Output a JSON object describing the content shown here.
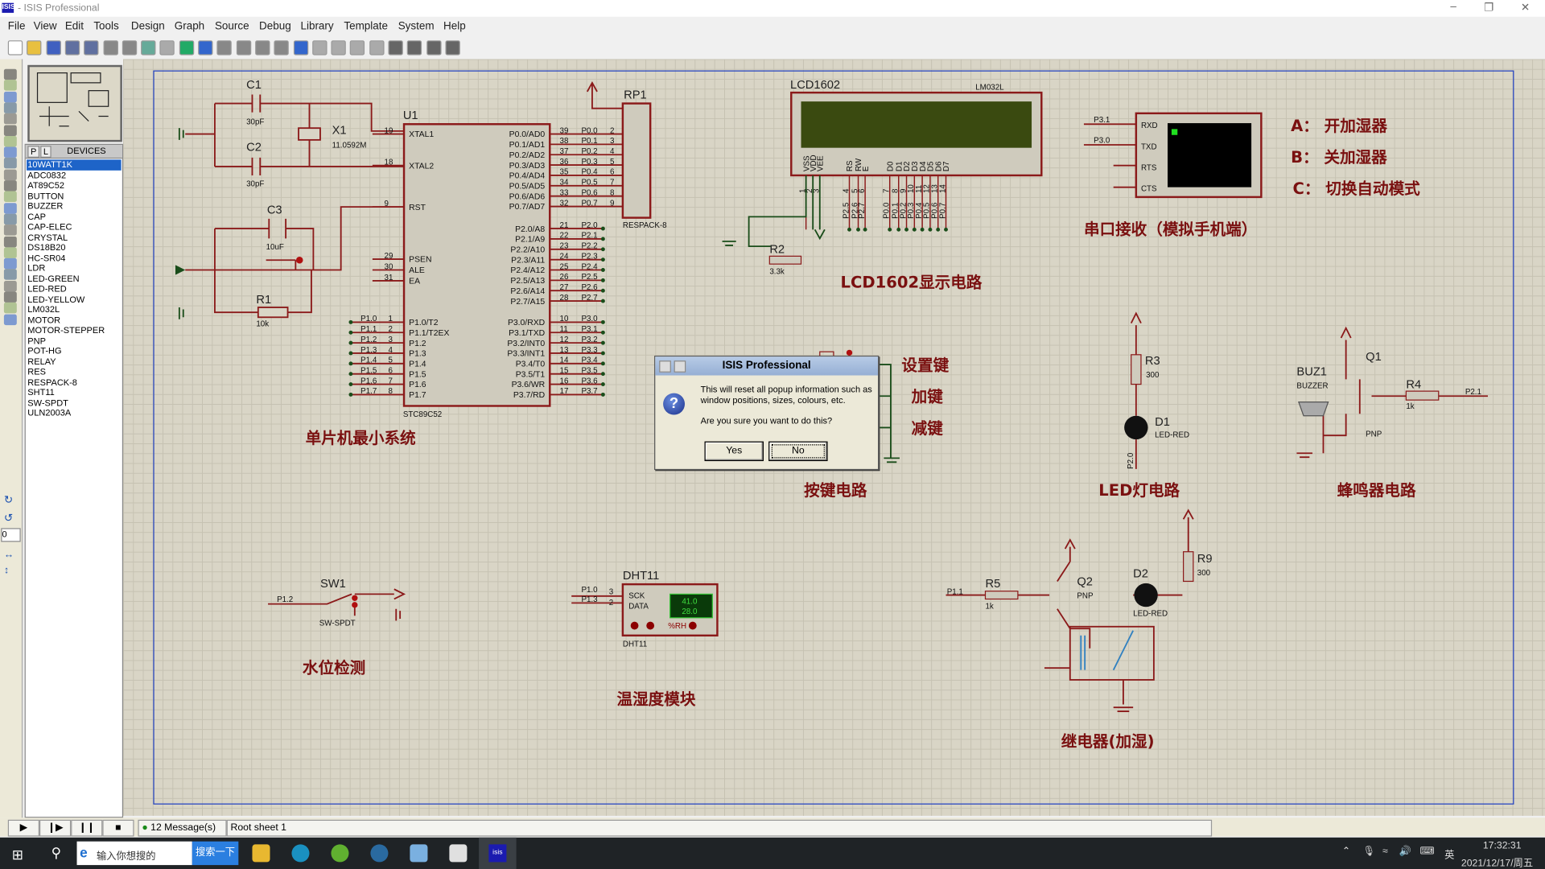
{
  "window": {
    "title": " - ISIS Professional",
    "app_icon": "ISIS",
    "controls": [
      "minimize",
      "restore",
      "close"
    ]
  },
  "menu": [
    "File",
    "View",
    "Edit",
    "Tools",
    "Design",
    "Graph",
    "Source",
    "Debug",
    "Library",
    "Template",
    "System",
    "Help"
  ],
  "device_panel": {
    "tab_p": "P",
    "tab_l": "L",
    "header": "DEVICES",
    "selected": "10WATT1K",
    "items": [
      "10WATT1K",
      "ADC0832",
      "AT89C52",
      "BUTTON",
      "BUZZER",
      "CAP",
      "CAP-ELEC",
      "CRYSTAL",
      "DS18B20",
      "HC-SR04",
      "LDR",
      "LED-GREEN",
      "LED-RED",
      "LED-YELLOW",
      "LM032L",
      "MOTOR",
      "MOTOR-STEPPER",
      "PNP",
      "POT-HG",
      "RELAY",
      "RES",
      "RESPACK-8",
      "SHT11",
      "SW-SPDT",
      "ULN2003A"
    ]
  },
  "rotation_value": "0",
  "schematic": {
    "titles": {
      "mcu": "单片机最小系统",
      "lcd": "LCD1602显示电路",
      "serial": "串口接收（模拟手机端）",
      "keys": "按键电路",
      "led": "LED灯电路",
      "buzzer": "蜂鸣器电路",
      "water": "水位检测",
      "dht": "温湿度模块",
      "relay": "继电器(加湿)",
      "set_key": "设置键",
      "plus_key": "加键",
      "minus_key": "减键"
    },
    "commands": [
      "A：  开加湿器",
      "B：  关加湿器",
      "C：  切换自动模式"
    ],
    "components": {
      "c1": "C1",
      "c1_val": "30pF",
      "c2": "C2",
      "c2_val": "30pF",
      "x1": "X1",
      "x1_val": "11.0592M",
      "c3": "C3",
      "c3_val": "10uF",
      "r1": "R1",
      "r1_val": "10k",
      "u1": "U1",
      "u1_part": "STC89C52",
      "rp1": "RP1",
      "rp1_part": "RESPACK-8",
      "lcd": "LCD1602",
      "lcd_part": "LM032L",
      "r2": "R2",
      "r2_val": "3.3k",
      "r3": "R3",
      "r3_val": "300",
      "d1": "D1",
      "d1_part": "LED-RED",
      "d1_net": "P2.0",
      "buz1": "BUZ1",
      "buz1_part": "BUZZER",
      "q1": "Q1",
      "q1_part": "PNP",
      "r4": "R4",
      "r4_val": "1k",
      "r4_net": "P2.1",
      "sw1": "SW1",
      "sw1_part": "SW-SPDT",
      "sw1_net": "P1.2",
      "dht": "DHT11",
      "dht_part": "DHT11",
      "dht_sck": "SCK",
      "dht_data": "DATA",
      "dht_net1": "P1.0",
      "dht_net2": "P1.3",
      "dht_pin1": "3",
      "dht_pin2": "2",
      "dht_hum": "41.0",
      "dht_temp": "28.0",
      "dht_unit": "%RH",
      "r5": "R5",
      "r5_val": "1k",
      "r5_net": "P1.1",
      "q2": "Q2",
      "q2_part": "PNP",
      "d2": "D2",
      "d2_part": "LED-RED",
      "r9": "R9",
      "r9_val": "300",
      "serial_pins": [
        "RXD",
        "TXD",
        "RTS",
        "CTS"
      ],
      "serial_nets": [
        "P3.1",
        "P3.0"
      ]
    },
    "mcu_left": [
      [
        "XTAL1",
        "19"
      ],
      [
        "XTAL2",
        "18"
      ],
      [
        "RST",
        "9"
      ],
      [
        "PSEN",
        "29"
      ],
      [
        "ALE",
        "30"
      ],
      [
        "EA",
        "31"
      ],
      [
        "P1.0/T2",
        "1"
      ],
      [
        "P1.1/T2EX",
        "2"
      ],
      [
        "P1.2",
        "3"
      ],
      [
        "P1.3",
        "4"
      ],
      [
        "P1.4",
        "5"
      ],
      [
        "P1.5",
        "6"
      ],
      [
        "P1.6",
        "7"
      ],
      [
        "P1.7",
        "8"
      ]
    ],
    "mcu_left_nets": [
      "P1.0",
      "P1.1",
      "P1.2",
      "P1.3",
      "P1.4",
      "P1.5",
      "P1.6",
      "P1.7"
    ],
    "mcu_p0": [
      [
        "P0.0/AD0",
        "39",
        "P0.0",
        "2"
      ],
      [
        "P0.1/AD1",
        "38",
        "P0.1",
        "3"
      ],
      [
        "P0.2/AD2",
        "37",
        "P0.2",
        "4"
      ],
      [
        "P0.3/AD3",
        "36",
        "P0.3",
        "5"
      ],
      [
        "P0.4/AD4",
        "35",
        "P0.4",
        "6"
      ],
      [
        "P0.5/AD5",
        "34",
        "P0.5",
        "7"
      ],
      [
        "P0.6/AD6",
        "33",
        "P0.6",
        "8"
      ],
      [
        "P0.7/AD7",
        "32",
        "P0.7",
        "9"
      ]
    ],
    "mcu_p2": [
      [
        "P2.0/A8",
        "21",
        "P2.0"
      ],
      [
        "P2.1/A9",
        "22",
        "P2.1"
      ],
      [
        "P2.2/A10",
        "23",
        "P2.2"
      ],
      [
        "P2.3/A11",
        "24",
        "P2.3"
      ],
      [
        "P2.4/A12",
        "25",
        "P2.4"
      ],
      [
        "P2.5/A13",
        "26",
        "P2.5"
      ],
      [
        "P2.6/A14",
        "27",
        "P2.6"
      ],
      [
        "P2.7/A15",
        "28",
        "P2.7"
      ]
    ],
    "mcu_p3": [
      [
        "P3.0/RXD",
        "10",
        "P3.0"
      ],
      [
        "P3.1/TXD",
        "11",
        "P3.1"
      ],
      [
        "P3.2/INT0",
        "12",
        "P3.2"
      ],
      [
        "P3.3/INT1",
        "13",
        "P3.3"
      ],
      [
        "P3.4/T0",
        "14",
        "P3.4"
      ],
      [
        "P3.5/T1",
        "15",
        "P3.5"
      ],
      [
        "P3.6/WR",
        "16",
        "P3.6"
      ],
      [
        "P3.7/RD",
        "17",
        "P3.7"
      ]
    ],
    "lcd_pins": [
      [
        "VSS",
        "1",
        ""
      ],
      [
        "VDD",
        "2",
        ""
      ],
      [
        "VEE",
        "3",
        ""
      ],
      [
        "RS",
        "4",
        "P2.5"
      ],
      [
        "RW",
        "5",
        "P2.6"
      ],
      [
        "E",
        "6",
        "P2.7"
      ],
      [
        "D0",
        "7",
        "P0.0"
      ],
      [
        "D1",
        "8",
        "P0.1"
      ],
      [
        "D2",
        "9",
        "P0.2"
      ],
      [
        "D3",
        "10",
        "P0.3"
      ],
      [
        "D4",
        "11",
        "P0.4"
      ],
      [
        "D5",
        "12",
        "P0.5"
      ],
      [
        "D6",
        "13",
        "P0.6"
      ],
      [
        "D7",
        "14",
        "P0.7"
      ]
    ]
  },
  "dialog": {
    "title": "ISIS Professional",
    "icon": "question-icon",
    "line1": "This will reset all popup information such as",
    "line2": "window positions, sizes, colours, etc.",
    "question": "Are you sure you want to do this?",
    "yes": "Yes",
    "no": "No"
  },
  "status": {
    "messages": "12 Message(s)",
    "sheet": "Root sheet 1",
    "sim_controls": [
      "play",
      "step",
      "pause",
      "stop"
    ]
  },
  "taskbar": {
    "search_placeholder": "输入你想搜的",
    "search_button": "搜索一下",
    "apps": [
      "file-explorer",
      "edge",
      "browser-green",
      "search-app",
      "photos",
      "office",
      "isis"
    ],
    "tray_lang": "英",
    "time": "17:32:31",
    "date": "2021/12/17/周五"
  },
  "colors": {
    "wire": "#8b1a1a",
    "net": "#1a4d1a",
    "annotation": "#7a1010",
    "canvas": "#d9d5c6",
    "selection": "#1e64c8"
  }
}
